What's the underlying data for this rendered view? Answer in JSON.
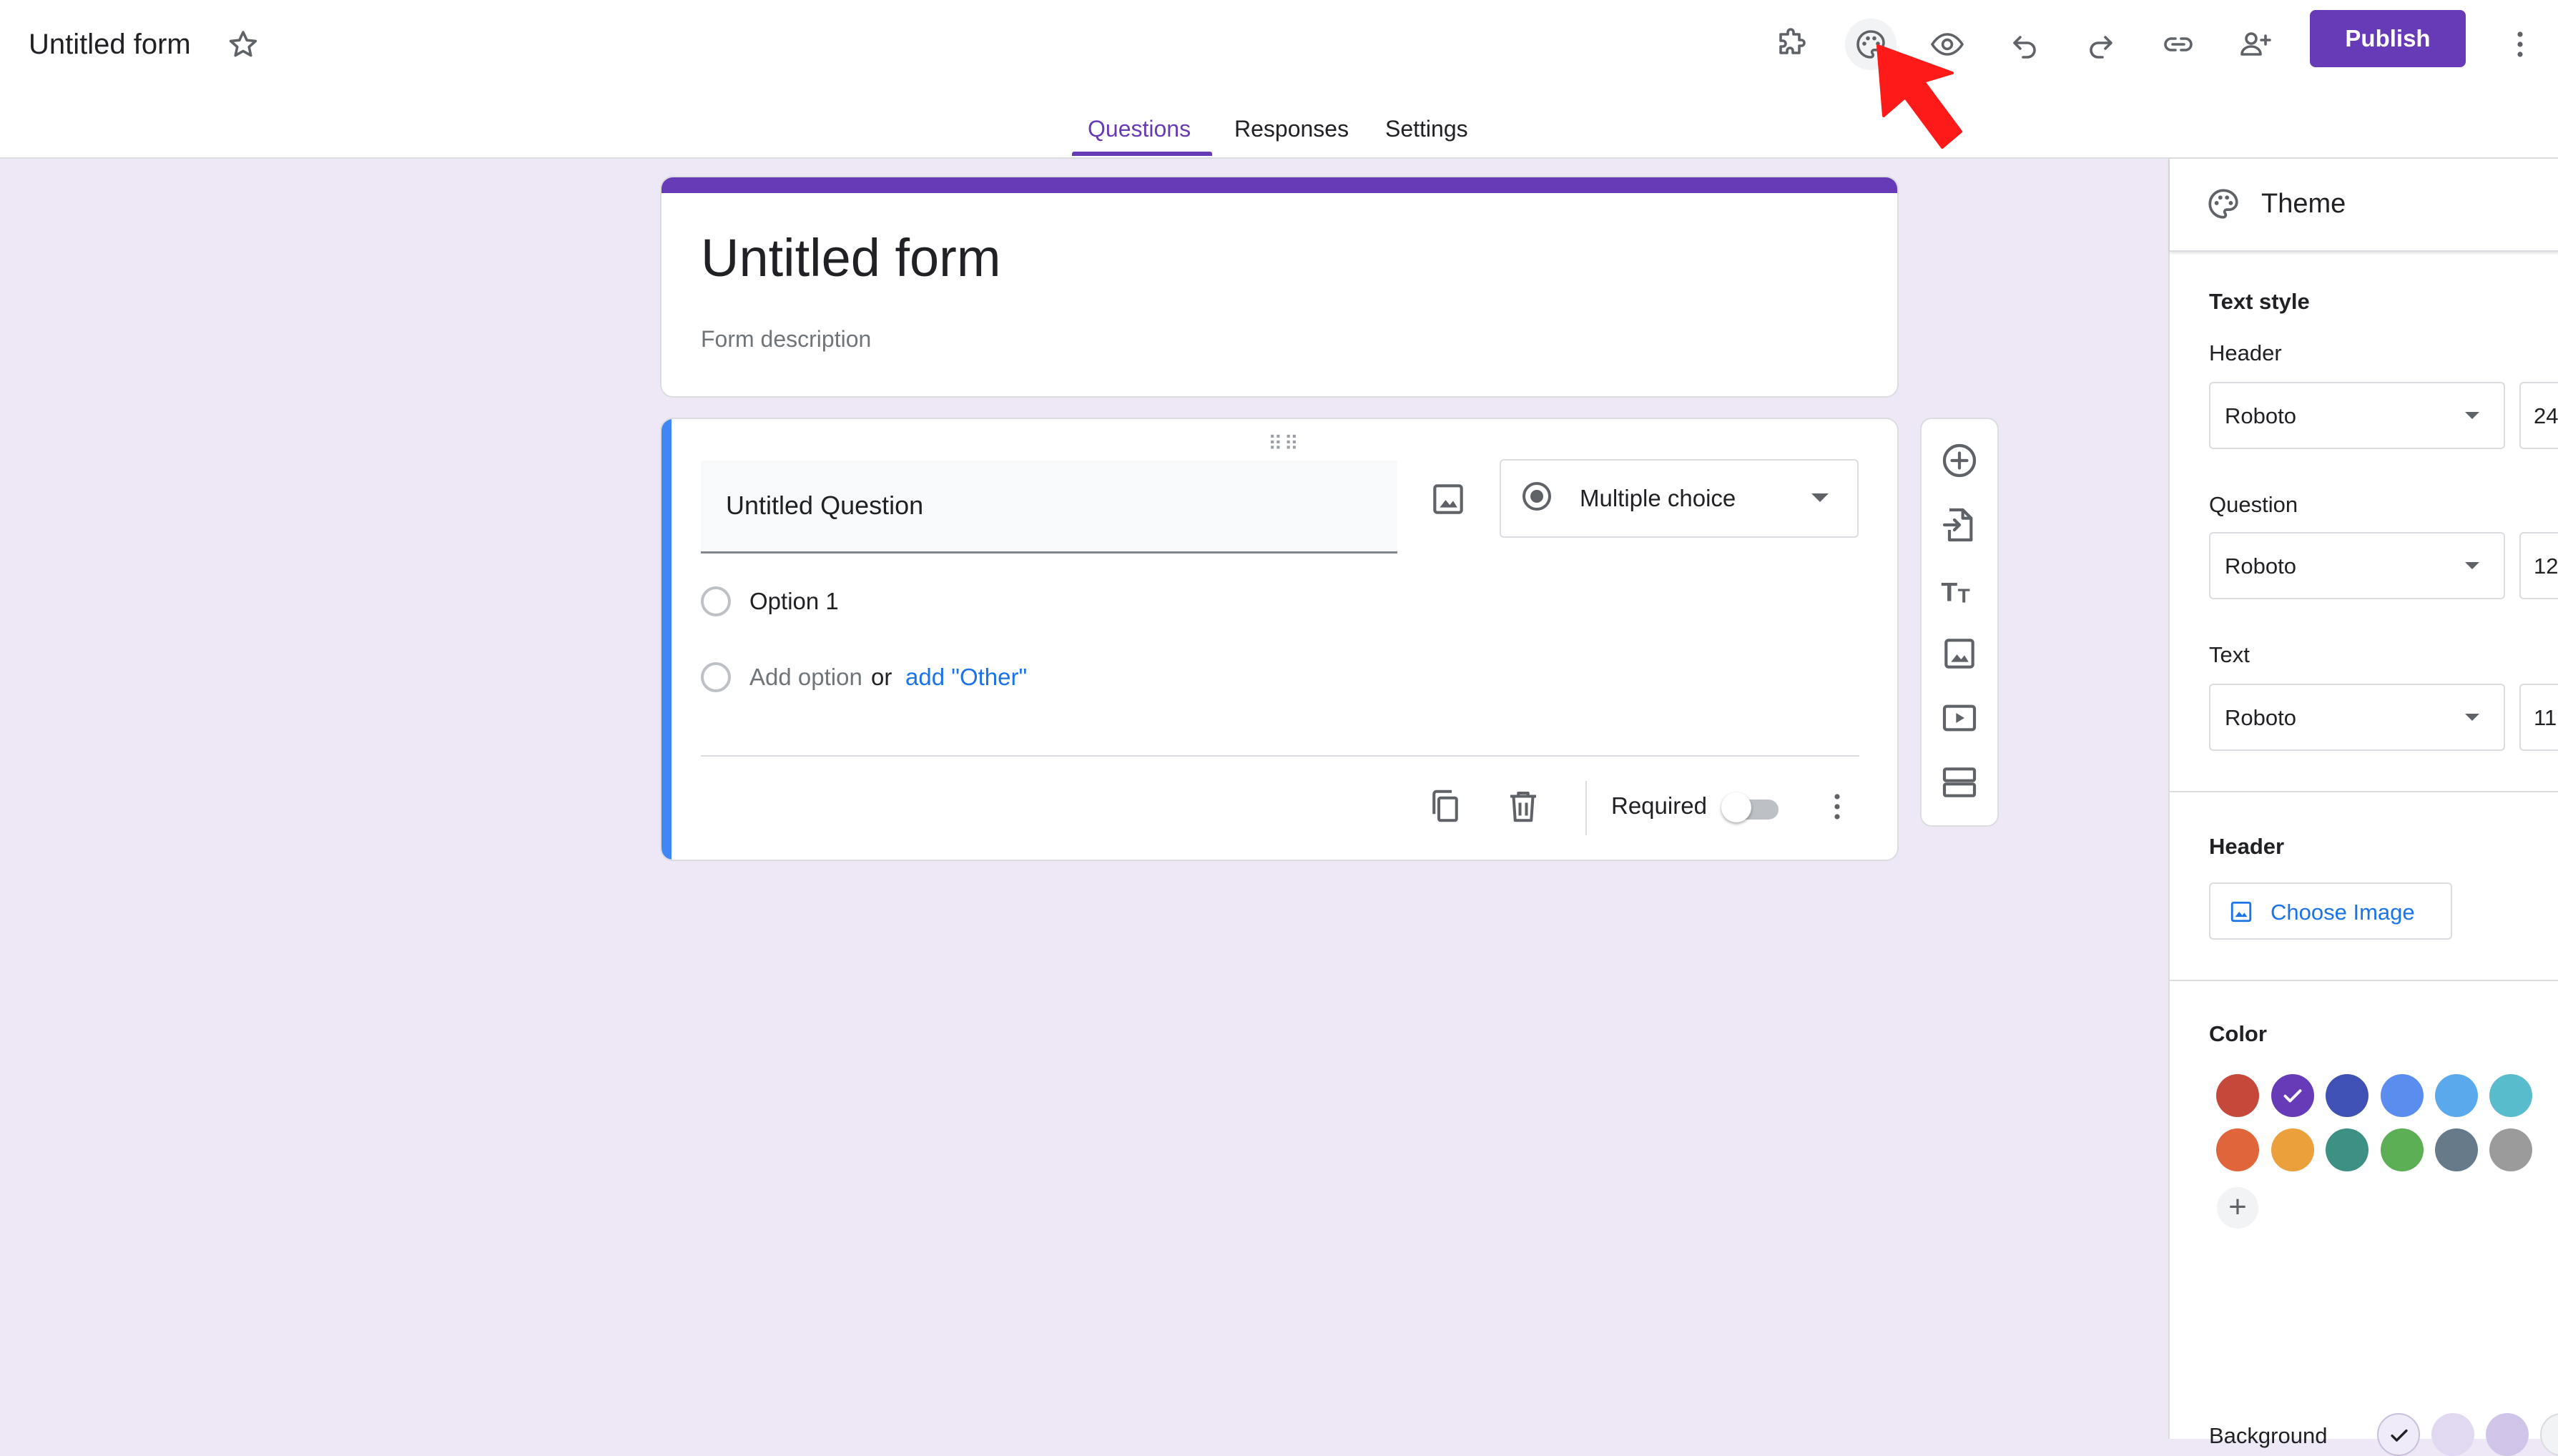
{
  "app": {
    "doc_title": "Untitled form",
    "publish_label": "Publish"
  },
  "toolbar_icons": [
    "addons-icon",
    "palette-icon",
    "preview-eye-icon",
    "undo-icon",
    "redo-icon",
    "link-icon",
    "add-collaborator-icon",
    "more-vert-icon"
  ],
  "tabs": [
    {
      "label": "Questions",
      "active": true
    },
    {
      "label": "Responses",
      "active": false
    },
    {
      "label": "Settings",
      "active": false
    }
  ],
  "form": {
    "title": "Untitled form",
    "description_placeholder": "Form description"
  },
  "question": {
    "title": "Untitled Question",
    "type": "Multiple choice",
    "options": [
      "Option 1"
    ],
    "add_option": "Add option",
    "or": "or",
    "add_other": "add \"Other\"",
    "required_label": "Required",
    "required": false
  },
  "theme": {
    "panel_title": "Theme",
    "text_style_label": "Text style",
    "header_label": "Header",
    "question_label": "Question",
    "text_label": "Text",
    "header_font": "Roboto",
    "header_size": "24",
    "question_font": "Roboto",
    "question_size": "12",
    "text_font": "Roboto",
    "text_size": "11",
    "header_section_label": "Header",
    "choose_image_label": "Choose Image",
    "color_label": "Color",
    "background_label": "Background",
    "colors": [
      "#db4437",
      "#673ab7",
      "#3f51b5",
      "#4285f4",
      "#03a9f4",
      "#00bcd4",
      "#ff5722",
      "#ff9800",
      "#009688",
      "#4caf50",
      "#607d8b",
      "#9e9e9e"
    ],
    "selected_color": "#673ab7",
    "backgrounds": [
      "#f0ebf8",
      "#e1d8f1",
      "#d1c4e9"
    ]
  },
  "accent_color": "#673ab7"
}
